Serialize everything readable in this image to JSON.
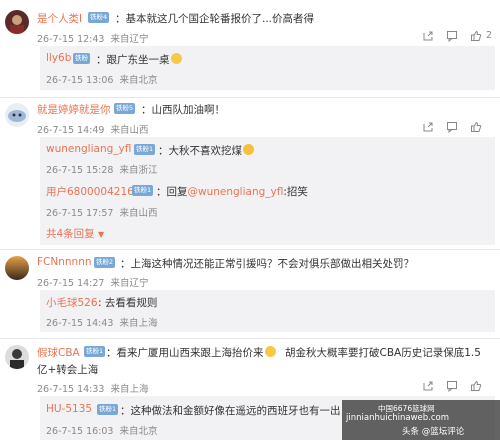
{
  "comments": [
    {
      "user": "是个人类I",
      "badge": "铁粉4",
      "text": "：基本就这几个国企轮番报价了...价高者得",
      "time": "26-7-15 12:43",
      "location": "来自辽宁",
      "like_count": "2",
      "replies": [
        {
          "user": "lly6b",
          "badge": "铁粉",
          "text": "：跟广东坐一桌",
          "time": "26-7-15 13:06",
          "location": "来自北京"
        }
      ]
    },
    {
      "user": "就是婷婷就是你",
      "badge": "铁粉5",
      "text": "：山西队加油啊！",
      "time": "26-7-15 14:49",
      "location": "来自山西",
      "replies": [
        {
          "user": "wunengliang_yfl",
          "badge": "铁粉1",
          "text": "：大秋不喜欢挖煤",
          "time": "26-7-15 15:28",
          "location": "来自浙江"
        },
        {
          "user": "用户6800004216",
          "badge": "铁粉1",
          "text": "：回复",
          "mention": "@wunengliang_yfl",
          "text2": ":招笑",
          "time": "26-7-15 17:57",
          "location": "来自山西"
        }
      ],
      "more_replies": "共4条回复"
    },
    {
      "user": "FCNnnnnn",
      "badge": "铁粉2",
      "text": "：上海这种情况还能正常引援吗？不会对俱乐部做出相关处罚？",
      "time": "26-7-15 14:27",
      "location": "来自辽宁",
      "replies": [
        {
          "user": "小毛球526",
          "text": ": 去看看规则",
          "time": "26-7-15 14:43",
          "location": "来自上海"
        }
      ]
    },
    {
      "user": "假球CBA",
      "badge": "铁粉1",
      "text_line1": "：看来广厦用山西来跟上海抬价来",
      "text_line1b": "胡金秋大概率要打破CBA历史记录保底1.5",
      "text_line2": "亿+转会上海",
      "time": "26-7-15 14:33",
      "location": "来自上海",
      "replies": [
        {
          "user": "HU-5135",
          "badge": "铁粉1",
          "text": "：这种做法和金额好像在遥远的西班牙也有一出",
          "time": "26-7-15 16:03",
          "location": "来自北京"
        }
      ]
    }
  ],
  "watermark": {
    "line1": "中国6676篮球网",
    "line2": "jinnianhuichinaweb.com",
    "line3": "头条 @篮坛评论"
  },
  "icons": [
    "share-icon",
    "comment-icon",
    "like-icon"
  ]
}
